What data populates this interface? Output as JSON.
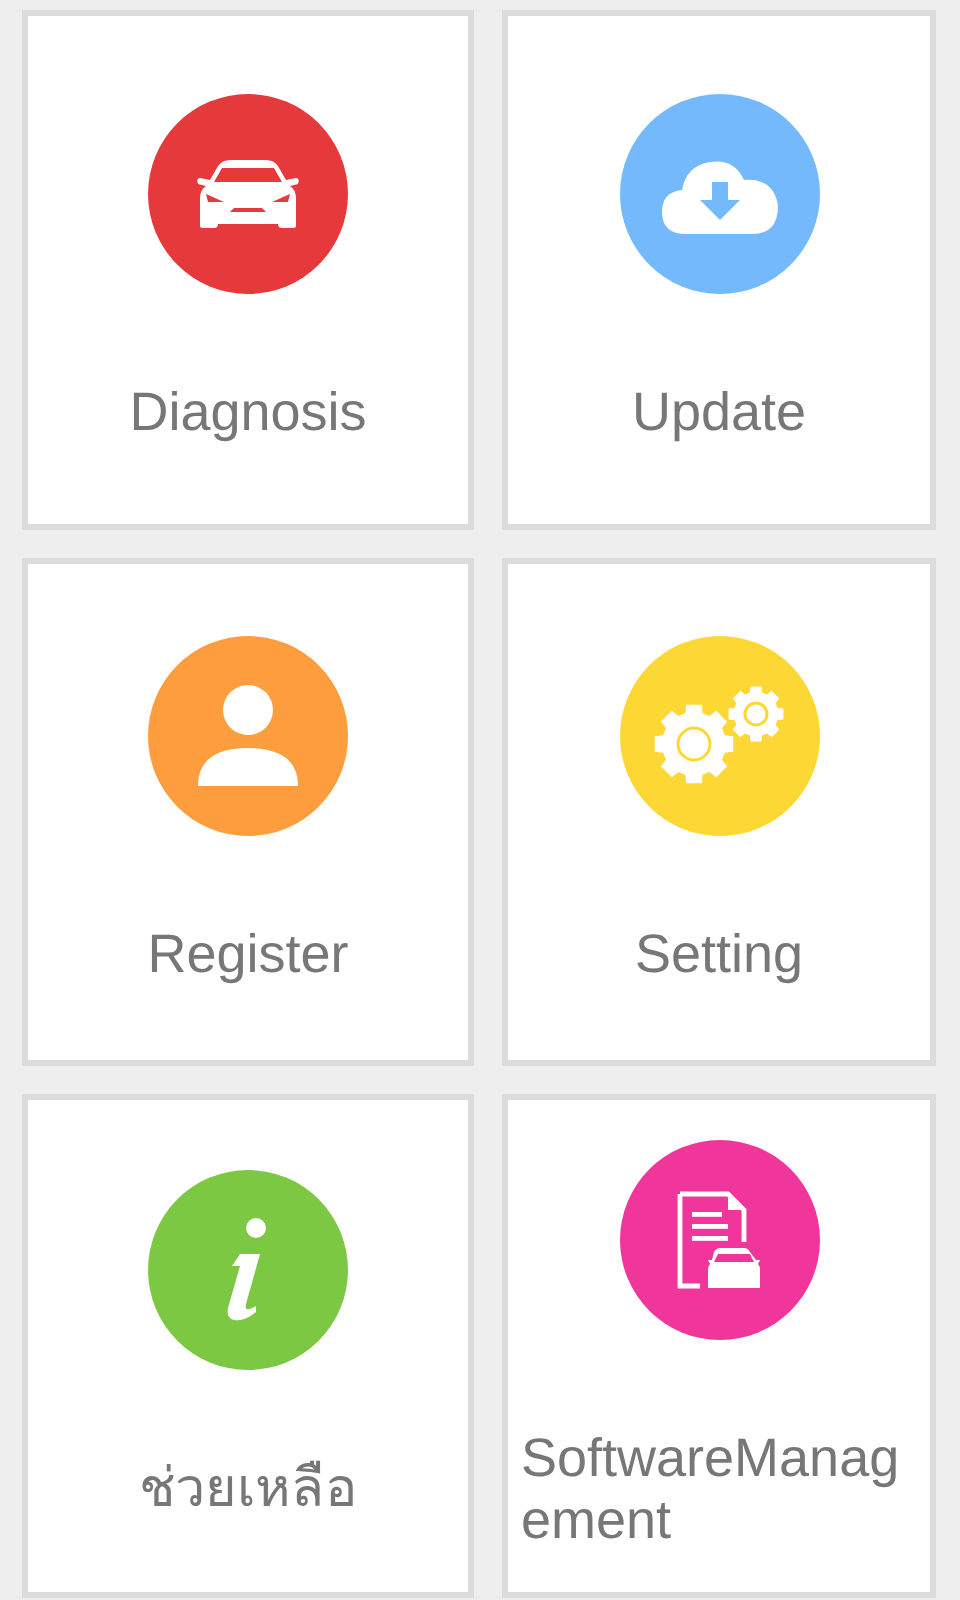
{
  "tiles": [
    {
      "label": "Diagnosis",
      "kind": "car",
      "color": "#e5393b"
    },
    {
      "label": "Update",
      "kind": "cloud",
      "color": "#74b9fb"
    },
    {
      "label": "Register",
      "kind": "person",
      "color": "#fd9d3d"
    },
    {
      "label": "Setting",
      "kind": "gears",
      "color": "#fdd835"
    },
    {
      "label": "ช่วยเหลือ",
      "kind": "info",
      "color": "#7cc843"
    },
    {
      "label": "SoftwareManagement",
      "kind": "doc",
      "color": "#f0369a"
    }
  ]
}
